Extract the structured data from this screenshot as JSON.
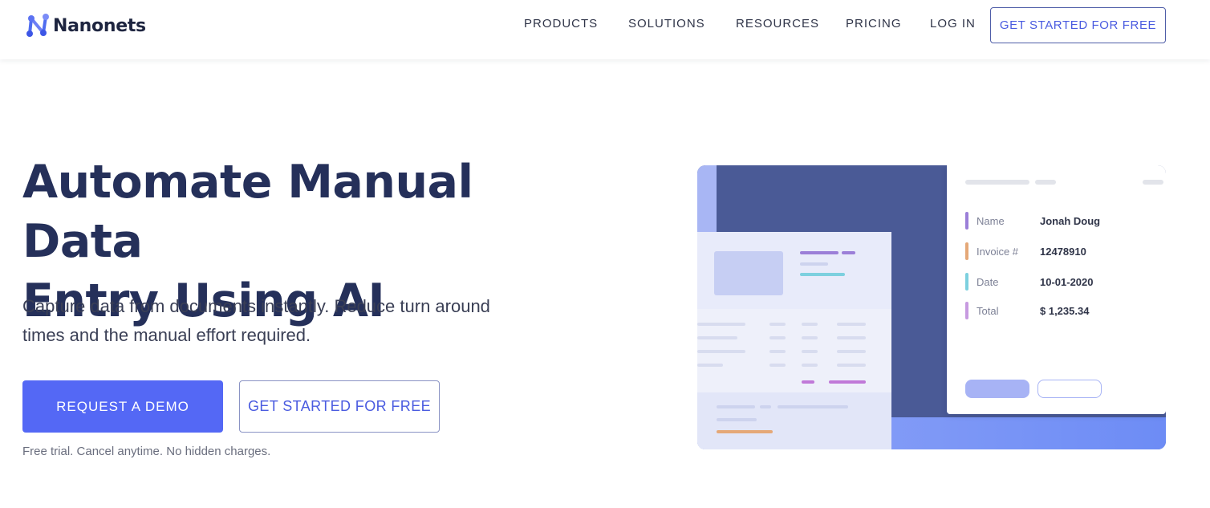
{
  "brand": {
    "name": "Nanonets",
    "accent": "#5468f5",
    "heading_color": "#25305a"
  },
  "nav": {
    "items": [
      "PRODUCTS",
      "SOLUTIONS",
      "RESOURCES",
      "PRICING",
      "LOG IN"
    ],
    "cta_label": "GET STARTED FOR FREE"
  },
  "hero": {
    "headline_line1": "Automate Manual Data",
    "headline_line2": "Entry Using AI",
    "subtext": "Capture data from documents instantly. Reduce turn around times and the manual effort required.",
    "demo_button": "REQUEST A DEMO",
    "free_button": "GET STARTED FOR FREE",
    "note": "Free trial. Cancel anytime. No hidden charges."
  },
  "illustration": {
    "fields": [
      {
        "label": "Name",
        "value": "Jonah Doug",
        "color": "#9b7fd8"
      },
      {
        "label": "Invoice #",
        "value": "12478910",
        "color": "#e5a878"
      },
      {
        "label": "Date",
        "value": "10-01-2020",
        "color": "#7dd0df"
      },
      {
        "label": "Total",
        "value": "$ 1,235.34",
        "color": "#c79ae0"
      }
    ]
  }
}
